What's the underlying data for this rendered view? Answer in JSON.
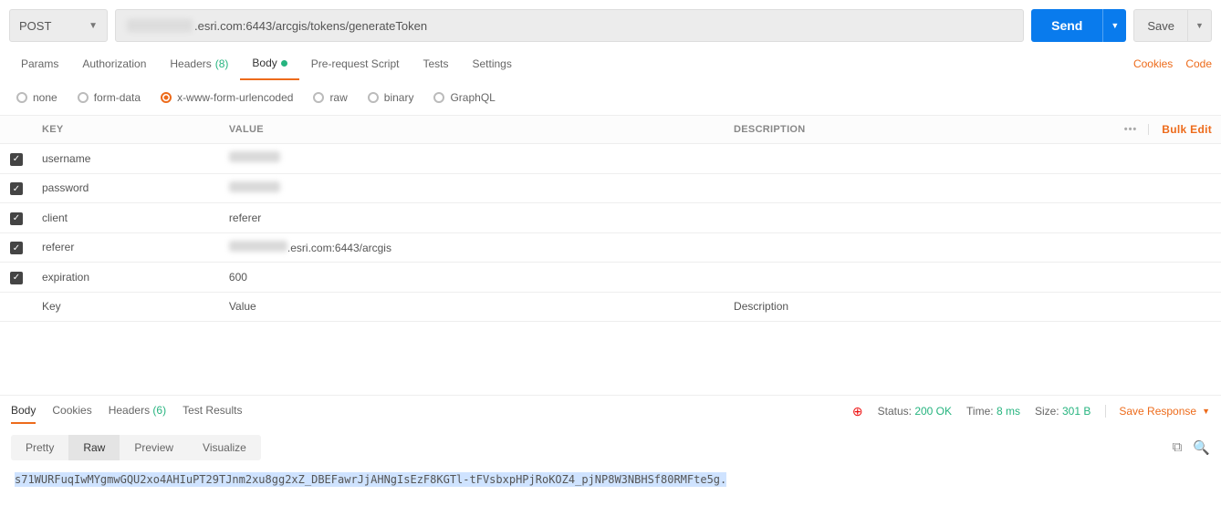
{
  "request": {
    "method": "POST",
    "url_prefix_hidden": true,
    "url_visible": ".esri.com:6443/arcgis/tokens/generateToken"
  },
  "buttons": {
    "send": "Send",
    "save": "Save"
  },
  "tabs": {
    "params": "Params",
    "authorization": "Authorization",
    "headers": "Headers",
    "headers_count": "(8)",
    "body": "Body",
    "prerequest": "Pre-request Script",
    "tests": "Tests",
    "settings": "Settings",
    "cookies_link": "Cookies",
    "code_link": "Code"
  },
  "body_types": {
    "none": "none",
    "formdata": "form-data",
    "xwww": "x-www-form-urlencoded",
    "raw": "raw",
    "binary": "binary",
    "graphql": "GraphQL"
  },
  "table": {
    "headers": {
      "key": "KEY",
      "value": "VALUE",
      "description": "DESCRIPTION",
      "bulk_edit": "Bulk Edit"
    },
    "rows": [
      {
        "key": "username",
        "value": "",
        "blur_value": true,
        "blur_w": 56
      },
      {
        "key": "password",
        "value": "",
        "blur_value": true,
        "blur_w": 56
      },
      {
        "key": "client",
        "value": "referer"
      },
      {
        "key": "referer",
        "value": ".esri.com:6443/arcgis",
        "blur_prefix": true,
        "blur_w": 64
      },
      {
        "key": "expiration",
        "value": "600"
      }
    ],
    "placeholders": {
      "key": "Key",
      "value": "Value",
      "description": "Description"
    }
  },
  "response": {
    "tabs": {
      "body": "Body",
      "cookies": "Cookies",
      "headers": "Headers",
      "headers_count": "(6)",
      "test_results": "Test Results"
    },
    "status_label": "Status:",
    "status_value": "200 OK",
    "time_label": "Time:",
    "time_value": "8 ms",
    "size_label": "Size:",
    "size_value": "301 B",
    "save_response": "Save Response",
    "views": {
      "pretty": "Pretty",
      "raw": "Raw",
      "preview": "Preview",
      "visualize": "Visualize"
    },
    "body_text": "s71WURFuqIwMYgmwGQU2xo4AHIuPT29TJnm2xu8gg2xZ_DBEFawrJjAHNgIsEzF8KGTl-tFVsbxpHPjRoKOZ4_pjNP8W3NBHSf80RMFte5g."
  }
}
